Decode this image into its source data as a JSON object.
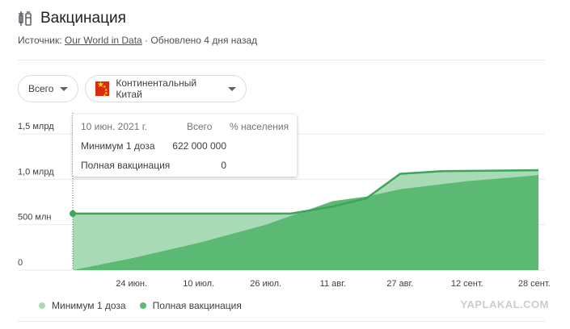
{
  "header": {
    "title": "Вакцинация",
    "source_label": "Источник:",
    "source_link": "Our World in Data",
    "updated": "· Обновлено 4 дня назад"
  },
  "filters": {
    "metric": "Всего",
    "region": "Континентальный Китай"
  },
  "tooltip": {
    "date": "10 июн. 2021 г.",
    "col_total": "Всего",
    "col_percent": "% населения",
    "rows": [
      {
        "label": "Минимум 1 доза",
        "value": "622 000 000"
      },
      {
        "label": "Полная вакцинация",
        "value": "0"
      }
    ]
  },
  "legend": [
    {
      "label": "Минимум 1 доза",
      "color": "#a8dab5"
    },
    {
      "label": "Полная вакцинация",
      "color": "#5bb974"
    }
  ],
  "watermark": "YAPLAKAL.COM",
  "chart_data": {
    "type": "area",
    "y_ticks": [
      {
        "value": 0,
        "label": "0"
      },
      {
        "value": 500000000,
        "label": "500 млн"
      },
      {
        "value": 1000000000,
        "label": "1,0 млрд"
      },
      {
        "value": 1500000000,
        "label": "1,5 млрд"
      }
    ],
    "ylim": [
      0,
      1500000000
    ],
    "x_domain": [
      "2021-06-10",
      "2021-09-29"
    ],
    "x_ticks": [
      {
        "date": "2021-06-24",
        "label": "24 июн."
      },
      {
        "date": "2021-07-10",
        "label": "10 июл."
      },
      {
        "date": "2021-07-26",
        "label": "26 июл."
      },
      {
        "date": "2021-08-11",
        "label": "11 авг."
      },
      {
        "date": "2021-08-27",
        "label": "27 авг."
      },
      {
        "date": "2021-09-12",
        "label": "12 сент."
      },
      {
        "date": "2021-09-28",
        "label": "28 сент."
      }
    ],
    "grid": true,
    "series": [
      {
        "name": "Минимум 1 доза",
        "color": "#a8dab5",
        "line_color": "#3ea45a",
        "points": [
          [
            "2021-06-10",
            622000000
          ],
          [
            "2021-07-10",
            622000000
          ],
          [
            "2021-07-26",
            622000000
          ],
          [
            "2021-08-01",
            622000000
          ],
          [
            "2021-08-11",
            700000000
          ],
          [
            "2021-08-19",
            790000000
          ],
          [
            "2021-08-27",
            1060000000
          ],
          [
            "2021-09-06",
            1090000000
          ],
          [
            "2021-09-28",
            1100000000
          ],
          [
            "2021-09-29",
            1100000000
          ]
        ]
      },
      {
        "name": "Полная вакцинация",
        "color": "#5bb974",
        "points": [
          [
            "2021-06-10",
            0
          ],
          [
            "2021-06-24",
            130000000
          ],
          [
            "2021-07-10",
            300000000
          ],
          [
            "2021-07-26",
            500000000
          ],
          [
            "2021-08-11",
            760000000
          ],
          [
            "2021-08-19",
            810000000
          ],
          [
            "2021-08-27",
            890000000
          ],
          [
            "2021-09-12",
            980000000
          ],
          [
            "2021-09-28",
            1040000000
          ],
          [
            "2021-09-29",
            1050000000
          ]
        ]
      }
    ]
  }
}
